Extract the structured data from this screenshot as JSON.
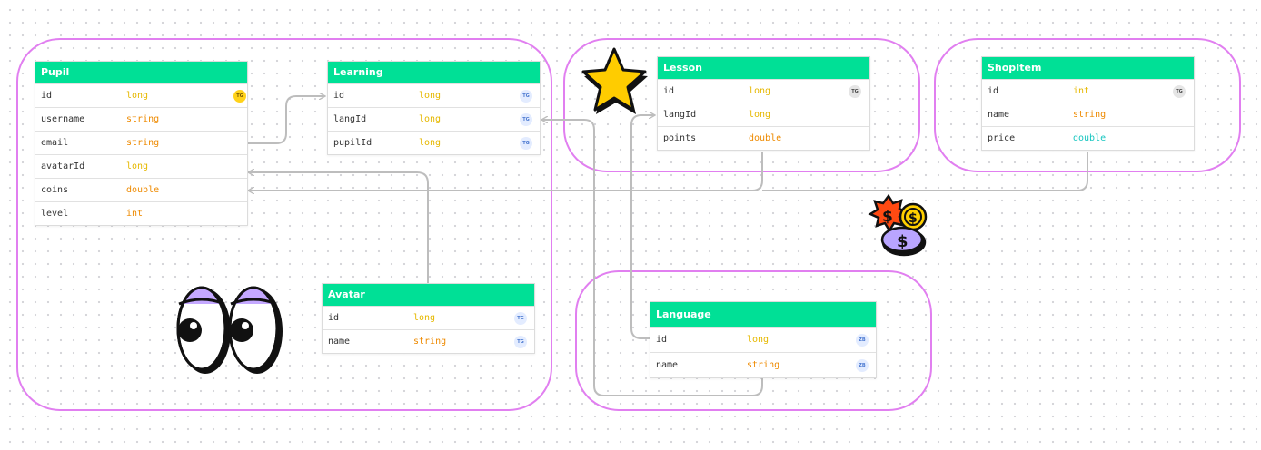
{
  "colors": {
    "header": "#00e096",
    "group_border": "#e17ff0",
    "link": "#bdbdbd",
    "type_long": "#e6b800",
    "type_string": "#ee8a00",
    "type_double": "#ee8a00",
    "type_int": "#ee8a00",
    "type_int_shop": "#e6b800",
    "type_double_shop": "#17c6c0"
  },
  "tables": {
    "pupil": {
      "title": "Pupil",
      "rows": [
        {
          "name": "id",
          "type": "long",
          "badge": "TG"
        },
        {
          "name": "username",
          "type": "string"
        },
        {
          "name": "email",
          "type": "string"
        },
        {
          "name": "avatarId",
          "type": "long"
        },
        {
          "name": "coins",
          "type": "double"
        },
        {
          "name": "level",
          "type": "int"
        }
      ]
    },
    "learning": {
      "title": "Learning",
      "rows": [
        {
          "name": "id",
          "type": "long",
          "badge": "TG"
        },
        {
          "name": "langId",
          "type": "long",
          "badge": "TG"
        },
        {
          "name": "pupilId",
          "type": "long",
          "badge": "TG"
        }
      ]
    },
    "lesson": {
      "title": "Lesson",
      "rows": [
        {
          "name": "id",
          "type": "long",
          "badge": "TG"
        },
        {
          "name": "langId",
          "type": "long"
        },
        {
          "name": "points",
          "type": "double"
        }
      ]
    },
    "shopitem": {
      "title": "ShopItem",
      "rows": [
        {
          "name": "id",
          "type": "int",
          "badge": "TG"
        },
        {
          "name": "name",
          "type": "string"
        },
        {
          "name": "price",
          "type": "double"
        }
      ]
    },
    "avatar": {
      "title": "Avatar",
      "rows": [
        {
          "name": "id",
          "type": "long",
          "badge": "TG"
        },
        {
          "name": "name",
          "type": "string",
          "badge": "TG"
        }
      ]
    },
    "language": {
      "title": "Language",
      "rows": [
        {
          "name": "id",
          "type": "long",
          "badge": "ZB"
        },
        {
          "name": "name",
          "type": "string",
          "badge": "ZB"
        }
      ]
    }
  },
  "decorations": {
    "star": "star-sticker-icon",
    "coins": "coins-sticker-icon",
    "eyes": "eyes-sticker-icon"
  },
  "coin_symbol": "$"
}
